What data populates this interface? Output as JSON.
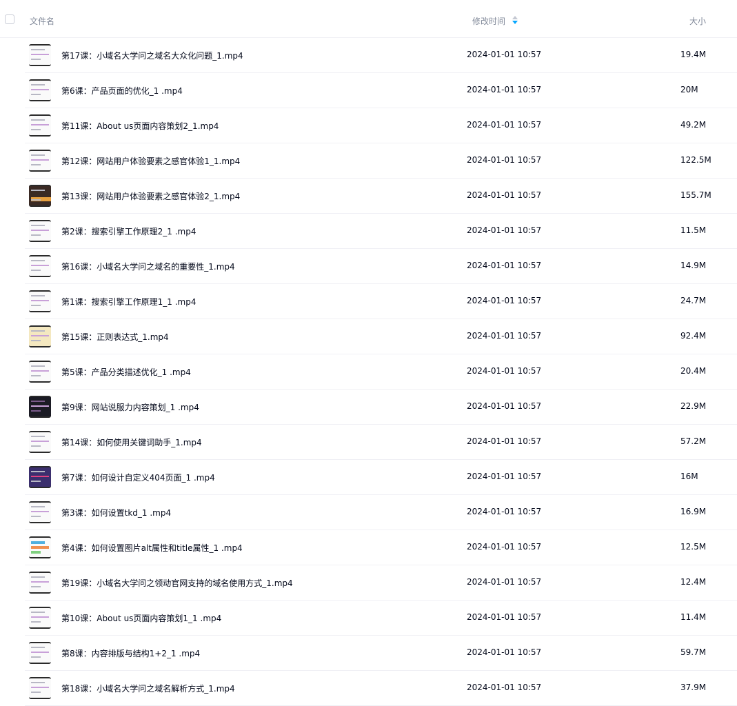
{
  "header": {
    "name_label": "文件名",
    "time_label": "修改时间",
    "size_label": "大小"
  },
  "files": [
    {
      "name": "第17课：小域名大学问之域名大众化问题_1.mp4",
      "time": "2024-01-01 10:57",
      "size": "19.4M",
      "thumb": "light"
    },
    {
      "name": "第6课：产品页面的优化_1 .mp4",
      "time": "2024-01-01 10:57",
      "size": "20M",
      "thumb": "light"
    },
    {
      "name": "第11课：About us页面内容策划2_1.mp4",
      "time": "2024-01-01 10:57",
      "size": "49.2M",
      "thumb": "light"
    },
    {
      "name": "第12课：网站用户体验要素之感官体验1_1.mp4",
      "time": "2024-01-01 10:57",
      "size": "122.5M",
      "thumb": "light"
    },
    {
      "name": "第13课：网站用户体验要素之感官体验2_1.mp4",
      "time": "2024-01-01 10:57",
      "size": "155.7M",
      "thumb": "warm"
    },
    {
      "name": "第2课：搜索引擎工作原理2_1 .mp4",
      "time": "2024-01-01 10:57",
      "size": "11.5M",
      "thumb": "light"
    },
    {
      "name": "第16课：小域名大学问之域名的重要性_1.mp4",
      "time": "2024-01-01 10:57",
      "size": "14.9M",
      "thumb": "light"
    },
    {
      "name": "第1课：搜索引擎工作原理1_1 .mp4",
      "time": "2024-01-01 10:57",
      "size": "24.7M",
      "thumb": "light"
    },
    {
      "name": "第15课：正则表达式_1.mp4",
      "time": "2024-01-01 10:57",
      "size": "92.4M",
      "thumb": "yellow"
    },
    {
      "name": "第5课：产品分类描述优化_1 .mp4",
      "time": "2024-01-01 10:57",
      "size": "20.4M",
      "thumb": "light"
    },
    {
      "name": "第9课：网站说服力内容策划_1 .mp4",
      "time": "2024-01-01 10:57",
      "size": "22.9M",
      "thumb": "dark"
    },
    {
      "name": "第14课：如何使用关键词助手_1.mp4",
      "time": "2024-01-01 10:57",
      "size": "57.2M",
      "thumb": "light"
    },
    {
      "name": "第7课：如何设计自定义404页面_1 .mp4",
      "time": "2024-01-01 10:57",
      "size": "16M",
      "thumb": "purple"
    },
    {
      "name": "第3课：如何设置tkd_1 .mp4",
      "time": "2024-01-01 10:57",
      "size": "16.9M",
      "thumb": "light"
    },
    {
      "name": "第4课：如何设置图片alt属性和title属性_1 .mp4",
      "time": "2024-01-01 10:57",
      "size": "12.5M",
      "thumb": "bars"
    },
    {
      "name": "第19课：小域名大学问之领动官网支持的域名使用方式_1.mp4",
      "time": "2024-01-01 10:57",
      "size": "12.4M",
      "thumb": "light"
    },
    {
      "name": "第10课：About us页面内容策划1_1 .mp4",
      "time": "2024-01-01 10:57",
      "size": "11.4M",
      "thumb": "light"
    },
    {
      "name": "第8课：内容排版与结构1+2_1 .mp4",
      "time": "2024-01-01 10:57",
      "size": "59.7M",
      "thumb": "light"
    },
    {
      "name": "第18课：小域名大学问之域名解析方式_1.mp4",
      "time": "2024-01-01 10:57",
      "size": "37.9M",
      "thumb": "light"
    }
  ],
  "colors": {
    "header_text": "#818999",
    "row_text": "#03081a",
    "divider": "#f0f0f5",
    "sort_active": "#06a7ff"
  }
}
